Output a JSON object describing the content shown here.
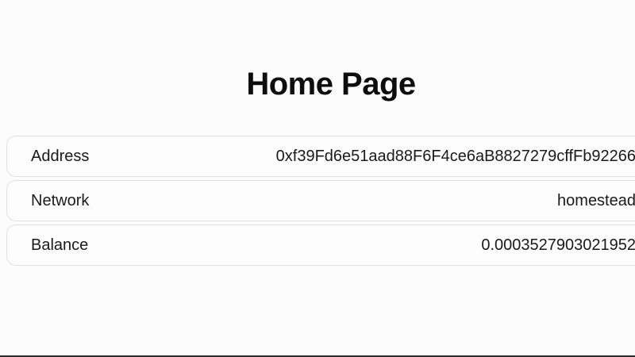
{
  "page": {
    "title": "Home Page"
  },
  "details": [
    {
      "label": "Address",
      "value": "0xf39Fd6e51aad88F6F4ce6aB8827279cffFb92266"
    },
    {
      "label": "Network",
      "value": "homestead"
    },
    {
      "label": "Balance",
      "value": "0.0003527903021952"
    }
  ],
  "colors": {
    "background": "#fdfcfd",
    "text": "#111111",
    "border": "#e3e1e6"
  }
}
